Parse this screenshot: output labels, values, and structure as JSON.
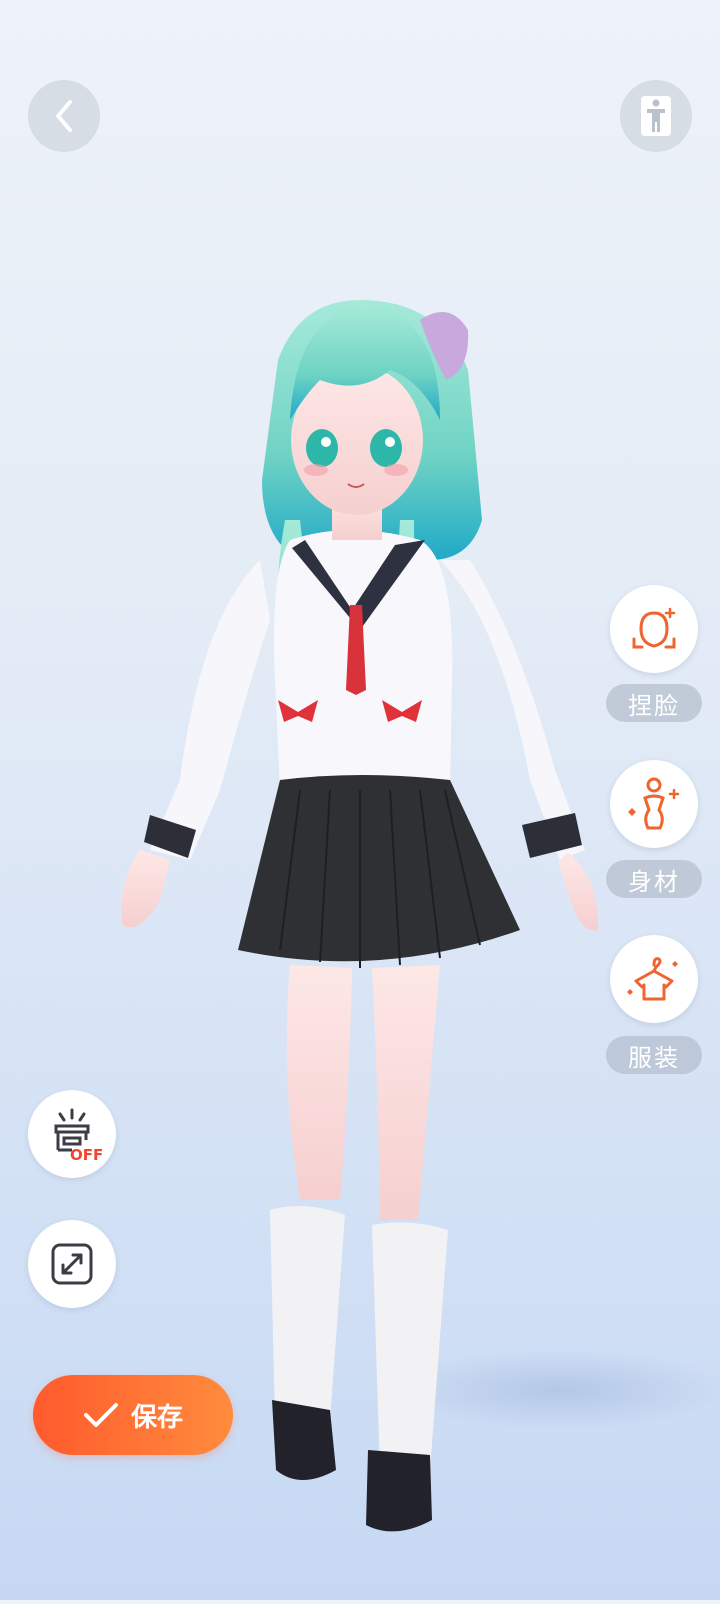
{
  "header": {
    "back_icon": "chevron-left-icon",
    "pose_icon": "standing-figure-icon"
  },
  "side_menu": [
    {
      "id": "face",
      "label": "捏脸",
      "icon": "face-shape-icon"
    },
    {
      "id": "body",
      "label": "身材",
      "icon": "body-shape-icon"
    },
    {
      "id": "outfit",
      "label": "服装",
      "icon": "hanger-clothes-icon"
    }
  ],
  "tools": {
    "lighting_toggle_text": "OFF",
    "lighting_icon": "spotlight-icon",
    "fullscreen_icon": "expand-icon"
  },
  "save": {
    "label": "保存",
    "icon": "check-icon"
  },
  "colors": {
    "accent": "#ff6a30",
    "icon_orange": "#f0642d"
  }
}
